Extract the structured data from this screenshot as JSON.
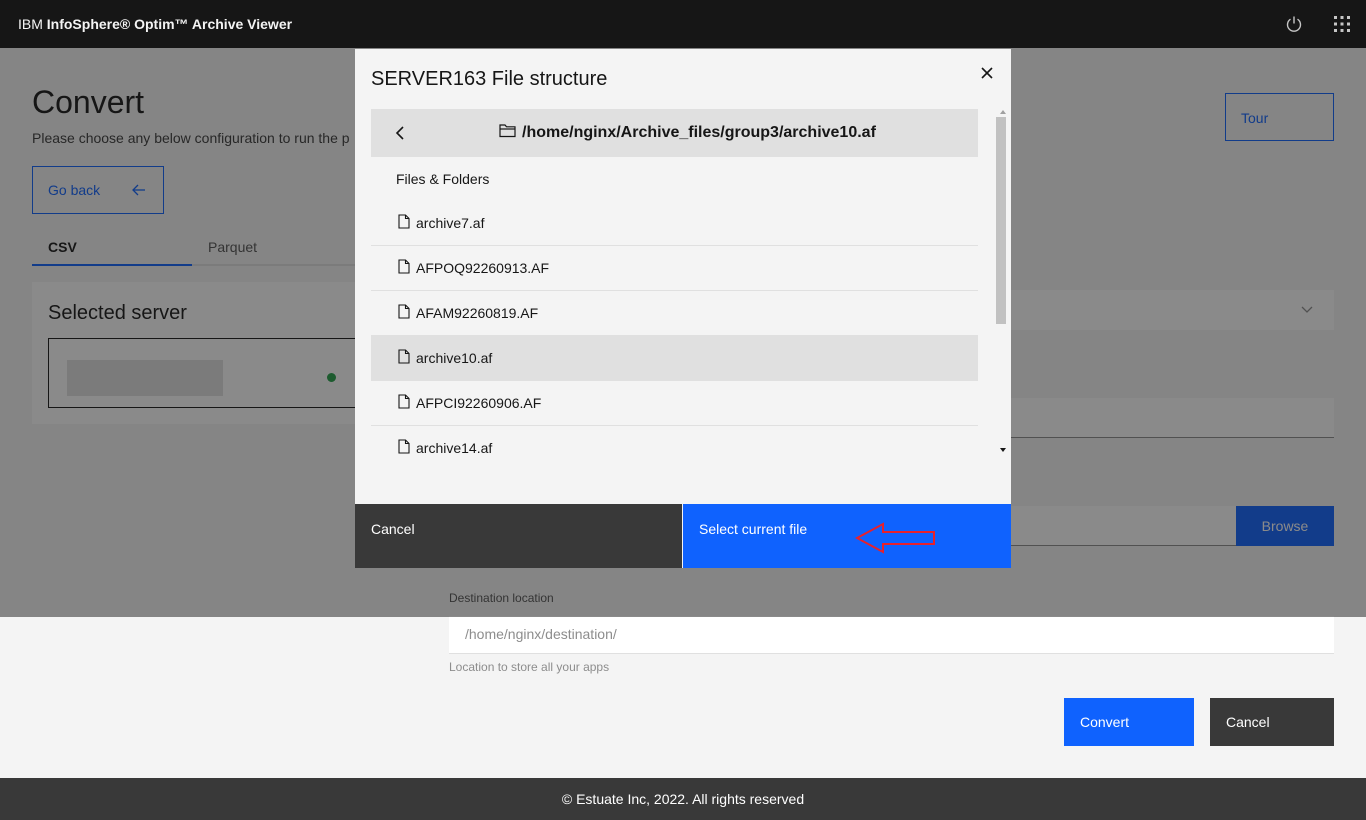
{
  "header": {
    "brand_prefix": "IBM ",
    "brand_bold": "InfoSphere® Optim™ Archive Viewer",
    "icons": [
      "power-icon",
      "app-switcher-icon"
    ]
  },
  "page": {
    "title": "Convert",
    "subtitle": "Please choose any below configuration to run the p",
    "go_back_label": "Go back",
    "tour_label": "Tour",
    "tabs": [
      {
        "label": "CSV",
        "active": true
      },
      {
        "label": "Parquet",
        "active": false
      }
    ],
    "selected_server_title": "Selected server",
    "browse_label": "Browse",
    "destination": {
      "label": "Destination location",
      "placeholder": "/home/nginx/destination/",
      "helper": "Location to store all your apps"
    },
    "convert_label": "Convert",
    "cancel_label": "Cancel"
  },
  "modal": {
    "title": "SERVER163 File structure",
    "path": "/home/nginx/Archive_files/group3/archive10.af",
    "files_heading": "Files & Folders",
    "files": [
      {
        "name": "archive7.af",
        "selected": false
      },
      {
        "name": "AFPOQ92260913.AF",
        "selected": false
      },
      {
        "name": "AFAM92260819.AF",
        "selected": false
      },
      {
        "name": "archive10.af",
        "selected": true
      },
      {
        "name": "AFPCI92260906.AF",
        "selected": false
      },
      {
        "name": "archive14.af",
        "selected": false
      }
    ],
    "cancel_label": "Cancel",
    "select_label": "Select current file"
  },
  "footer": {
    "text": "© Estuate Inc, 2022.  All rights reserved"
  },
  "colors": {
    "primary": "#0f62fe",
    "header_bg": "#161616",
    "annotation_arrow": "#e8212b",
    "status_online": "#24a148"
  }
}
